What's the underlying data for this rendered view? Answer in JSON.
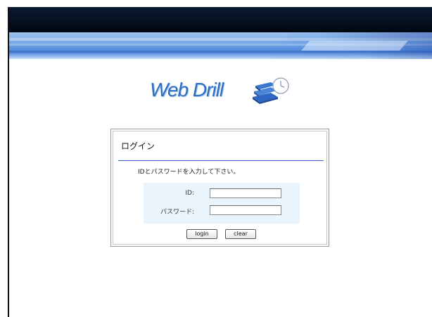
{
  "header": {
    "logo_text": "Web Drill",
    "logo_icon": "books-clock-icon"
  },
  "login": {
    "title": "ログイン",
    "instruction": "IDとパスワードを入力して下さい。",
    "id_label": "ID:",
    "id_value": "",
    "password_label": "パスワード:",
    "password_value": "",
    "login_button": "login",
    "clear_button": "clear"
  },
  "colors": {
    "header_dark": "#020812",
    "banner_blue": "#6fa3e6",
    "logo_blue": "#2e6fc0",
    "rule_blue": "#3f5fcf",
    "field_panel": "#eaf4fd"
  }
}
